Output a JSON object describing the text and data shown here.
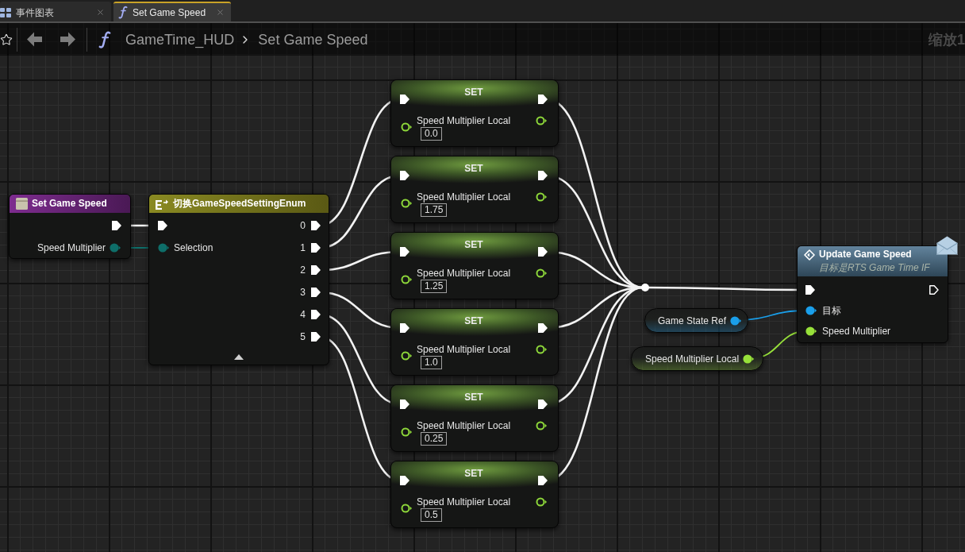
{
  "tabs": [
    {
      "kind": "graph",
      "label": "事件图表",
      "selected": false
    },
    {
      "kind": "function",
      "label": "Set Game Speed",
      "selected": true
    }
  ],
  "breadcrumb": [
    "GameTime_HUD",
    "Set Game Speed"
  ],
  "zoom_label": "缩放1",
  "entry_node": {
    "title": "Set Game Speed",
    "pins": [
      {
        "label": "Speed Multiplier",
        "color": "#0e6e69"
      }
    ]
  },
  "switch_node": {
    "title": "切换GameSpeedSettingEnum",
    "input_pins": [
      {
        "label": "Selection",
        "color": "#0e6e69"
      }
    ],
    "outputs": [
      "0",
      "1",
      "2",
      "3",
      "4",
      "5"
    ]
  },
  "set_nodes": [
    {
      "title": "SET",
      "variable": "Speed Multiplier Local",
      "value": "0.0",
      "linked": false
    },
    {
      "title": "SET",
      "variable": "Speed Multiplier Local",
      "value": "1.75",
      "linked": false
    },
    {
      "title": "SET",
      "variable": "Speed Multiplier Local",
      "value": "1.25",
      "linked": false
    },
    {
      "title": "SET",
      "variable": "Speed Multiplier Local",
      "value": "1.0",
      "linked": false
    },
    {
      "title": "SET",
      "variable": "Speed Multiplier Local",
      "value": "0.25",
      "linked": false
    },
    {
      "title": "SET",
      "variable": "Speed Multiplier Local",
      "value": "0.5",
      "linked": false
    }
  ],
  "variable_nodes": [
    {
      "label": "Game State Ref",
      "color": "#1a9fea"
    },
    {
      "label": "Speed Multiplier Local",
      "color": "#97e13a"
    }
  ],
  "call_node": {
    "title": "Update Game Speed",
    "subtitle": "目标是RTS Game Time IF",
    "exec_out_linked": false,
    "pins": [
      {
        "label": "目标",
        "color": "#1a9fea"
      },
      {
        "label": "Speed Multiplier",
        "color": "#97e13a"
      }
    ]
  }
}
